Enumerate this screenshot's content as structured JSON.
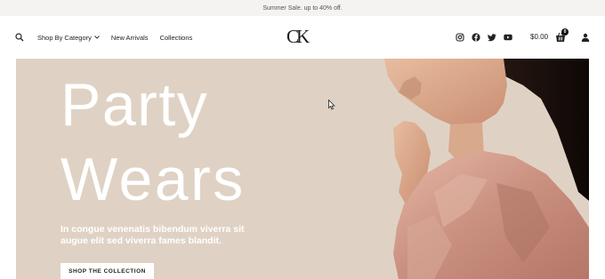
{
  "announcement": {
    "text": "Summer Sale. up to 40% off."
  },
  "header": {
    "nav": [
      {
        "label": "Shop By Category",
        "has_dropdown": true
      },
      {
        "label": "New Arrivals"
      },
      {
        "label": "Collections"
      }
    ],
    "logo": "CK",
    "social_icons": [
      "instagram-icon",
      "facebook-icon",
      "twitter-icon",
      "youtube-icon"
    ],
    "cart": {
      "amount": "$0.00",
      "count": "0"
    }
  },
  "hero": {
    "title_line1": "Party",
    "title_line2": "Wears",
    "text": "In congue venenatis bibendum viverra sit augue elit sed viverra fames blandit.",
    "cta_label": "SHOP THE COLLECTION"
  },
  "colors": {
    "hero_bg": "#dfd2c4",
    "announcement_bg": "#f4f3f1",
    "text_dark": "#222222",
    "cta_bg": "#ffffff"
  }
}
